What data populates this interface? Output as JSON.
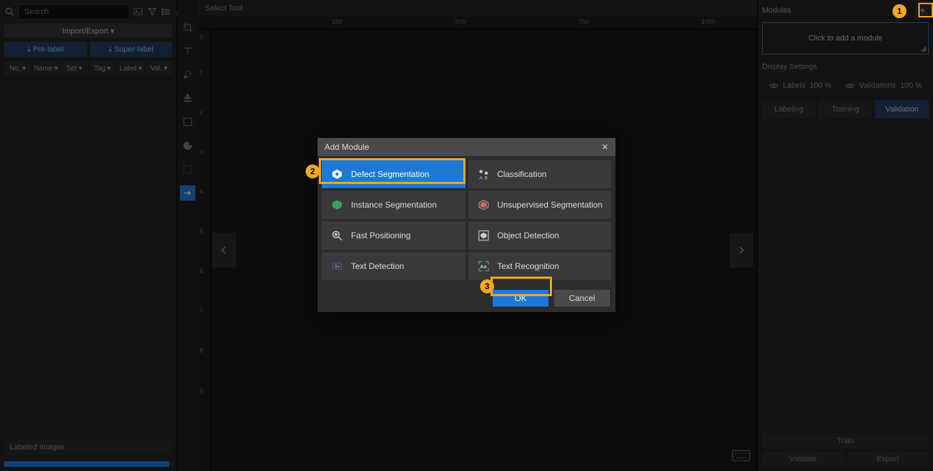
{
  "left": {
    "search_placeholder": "Search",
    "import_export": "Import/Export ▾",
    "prelabel": "⤓  Pre-label",
    "superlabel": "⤓  Super-label",
    "filters": {
      "no": "No. ▾",
      "name": "Name ▾",
      "set": "Set ▾",
      "tag": "Tag ▾",
      "label": "Label ▾",
      "val": "Val. ▾"
    },
    "labeled_images": "Labeled Images"
  },
  "center": {
    "tool_label": "Select Tool",
    "ruler_h": [
      "250",
      "500",
      "750",
      "1000"
    ],
    "ruler_v": [
      "0",
      "1",
      "2",
      "3",
      "4",
      "5",
      "6",
      "7",
      "8",
      "9"
    ]
  },
  "right": {
    "modules_label": "Modules",
    "add_module_hint": "Click to add a module",
    "display_settings": "Display Settings",
    "labels": "Labels",
    "labels_pct": "100 %",
    "validations": "Validations",
    "validations_pct": "100 %",
    "tabs": {
      "labeling": "Labeling",
      "training": "Training",
      "validation": "Validation"
    },
    "train": "Train",
    "validate": "Validate",
    "export": "Export"
  },
  "modal": {
    "title": "Add Module",
    "options": {
      "defect_seg": "Defect Segmentation",
      "classification": "Classification",
      "instance_seg": "Instance Segmentation",
      "unsup_seg": "Unsupervised Segmentation",
      "fast_pos": "Fast Positioning",
      "obj_det": "Object Detection",
      "text_det": "Text Detection",
      "text_rec": "Text Recognition"
    },
    "ok": "OK",
    "cancel": "Cancel"
  },
  "callouts": {
    "c1": "1",
    "c2": "2",
    "c3": "3"
  }
}
